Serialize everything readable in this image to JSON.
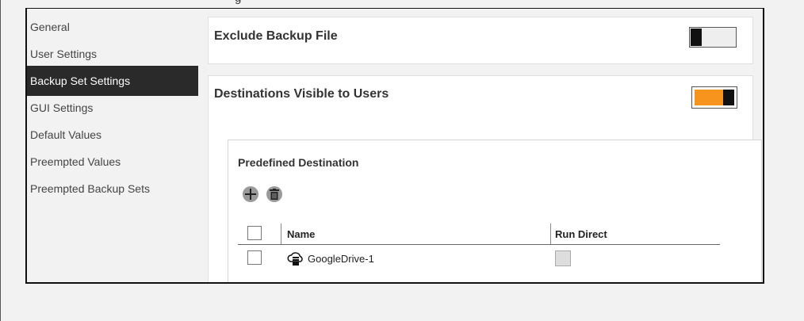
{
  "header": {
    "title_fragment": "g"
  },
  "sidebar": {
    "items": [
      {
        "label": "General"
      },
      {
        "label": "User Settings"
      },
      {
        "label": "Backup Set Settings"
      },
      {
        "label": "GUI Settings"
      },
      {
        "label": "Default Values"
      },
      {
        "label": "Preempted Values"
      },
      {
        "label": "Preempted Backup Sets"
      }
    ],
    "active_index": 2
  },
  "sections": {
    "exclude_backup_file": {
      "title": "Exclude Backup File",
      "toggle": "off"
    },
    "destinations": {
      "title": "Destinations Visible to Users",
      "toggle": "on",
      "accent_color": "#f7941d",
      "predefined": {
        "title": "Predefined Destination",
        "add_icon": "plus-circle-icon",
        "delete_icon": "trash-icon",
        "columns": {
          "name": "Name",
          "run_direct": "Run Direct"
        },
        "rows": [
          {
            "name": "GoogleDrive-1",
            "icon": "cloud-server-icon",
            "run_direct": false,
            "checked": false
          }
        ]
      }
    }
  }
}
